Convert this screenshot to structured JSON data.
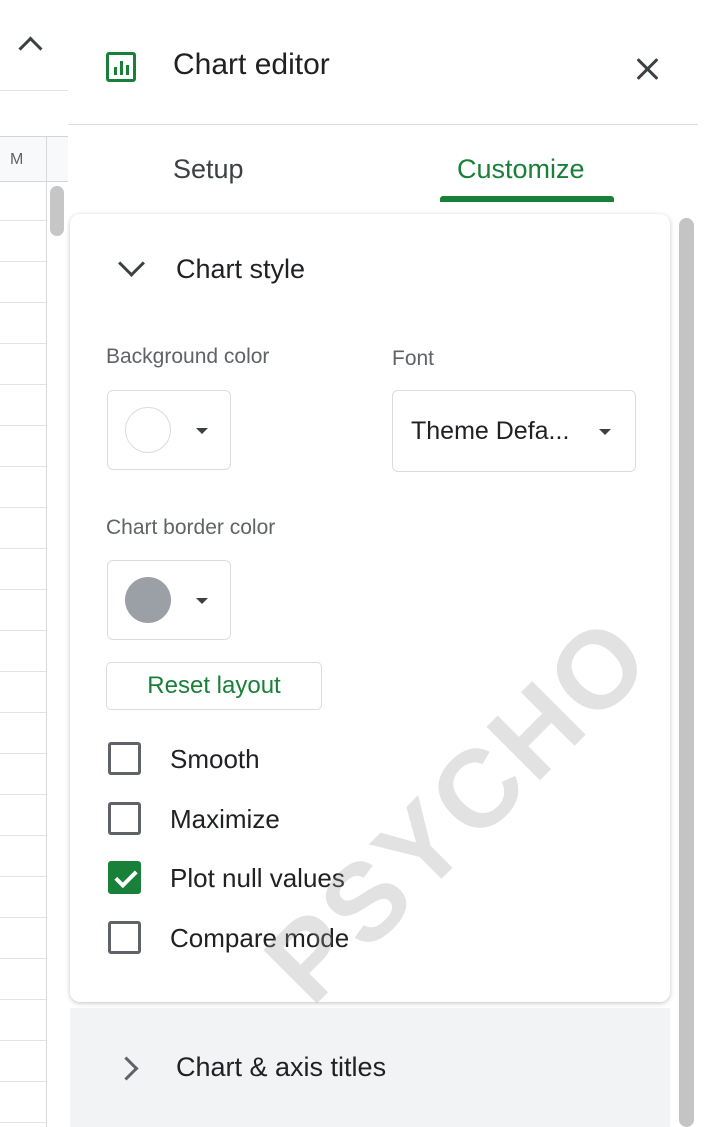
{
  "sheet": {
    "column_header": "M"
  },
  "editor": {
    "title": "Chart editor",
    "tabs": [
      {
        "label": "Setup",
        "active": false
      },
      {
        "label": "Customize",
        "active": true
      }
    ],
    "chart_style": {
      "section_title": "Chart style",
      "background_color": {
        "label": "Background color",
        "value_color": "#ffffff"
      },
      "font": {
        "label": "Font",
        "value": "Theme Defa..."
      },
      "chart_border_color": {
        "label": "Chart border color",
        "value_color": "#9aa0a6"
      },
      "reset_button": "Reset layout",
      "options": [
        {
          "label": "Smooth",
          "checked": false
        },
        {
          "label": "Maximize",
          "checked": false
        },
        {
          "label": "Plot null values",
          "checked": true
        },
        {
          "label": "Compare mode",
          "checked": false
        }
      ]
    },
    "collapsed_sections": [
      {
        "title": "Chart & axis titles"
      }
    ]
  },
  "colors": {
    "accent": "#188038",
    "text": "#202124",
    "muted": "#5f6368"
  },
  "watermark": "PSYCHO"
}
